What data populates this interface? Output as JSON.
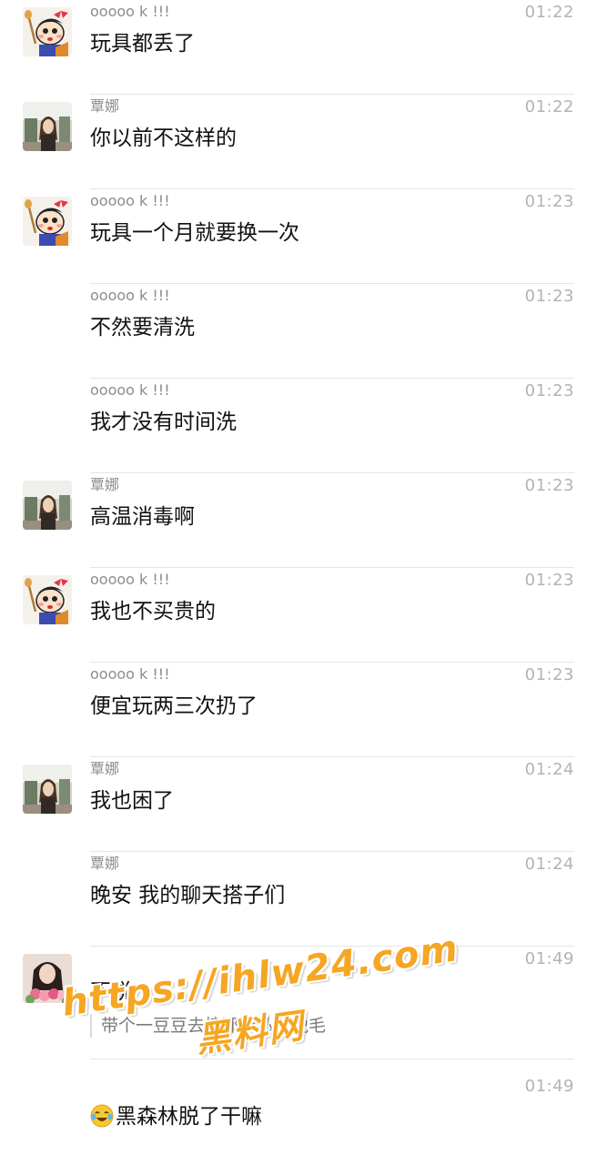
{
  "colors": {
    "timestamp": "#b3b3b3",
    "sender": "#8c8c8c",
    "message_text": "#111111",
    "divider": "#e6e6e6",
    "watermark": "#f5a623"
  },
  "messages": [
    {
      "sender": "ooooo k !!!",
      "time": "01:22",
      "text": "玩具都丢了",
      "avatar": "crayon-shinchan-avatar"
    },
    {
      "sender": "覃娜",
      "time": "01:22",
      "text": "你以前不这样的",
      "avatar": "woman-cafe-avatar"
    },
    {
      "sender": "ooooo k !!!",
      "time": "01:23",
      "text": "玩具一个月就要换一次",
      "avatar": "crayon-shinchan-avatar"
    },
    {
      "sender": "ooooo k !!!",
      "time": "01:23",
      "text": "不然要清洗",
      "avatar": ""
    },
    {
      "sender": "ooooo k !!!",
      "time": "01:23",
      "text": "我才没有时间洗",
      "avatar": ""
    },
    {
      "sender": "覃娜",
      "time": "01:23",
      "text": "高温消毒啊",
      "avatar": "woman-cafe-avatar"
    },
    {
      "sender": "ooooo k !!!",
      "time": "01:23",
      "text": "我也不买贵的",
      "avatar": "crayon-shinchan-avatar"
    },
    {
      "sender": "ooooo k !!!",
      "time": "01:23",
      "text": "便宜玩两三次扔了",
      "avatar": ""
    },
    {
      "sender": "覃娜",
      "time": "01:24",
      "text": "我也困了",
      "avatar": "woman-cafe-avatar"
    },
    {
      "sender": "覃娜",
      "time": "01:24",
      "text": "晚安 我的聊天搭子们",
      "avatar": ""
    },
    {
      "sender": "",
      "time": "01:49",
      "text": "不脱",
      "quote": "带个一豆豆去搞那个私密脱毛",
      "avatar": "girl-flowers-avatar"
    },
    {
      "sender": "",
      "time": "01:49",
      "text": "黑森林脱了干嘛",
      "emoji": "laughing-crying-emoji",
      "avatar": ""
    }
  ],
  "watermark": {
    "url": "https://ihlw24.com",
    "name": "黑料网"
  }
}
